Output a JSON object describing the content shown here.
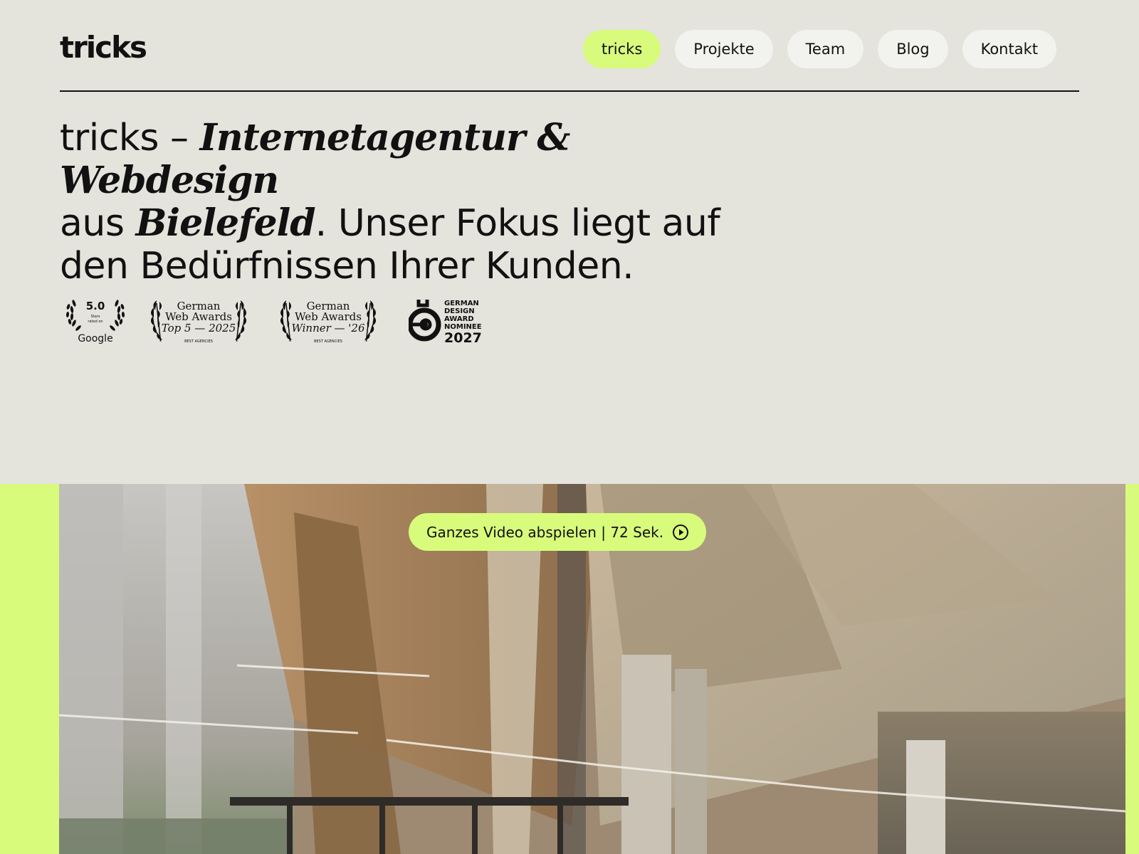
{
  "header": {
    "logo": "tricks",
    "nav": [
      {
        "label": "tricks",
        "active": true
      },
      {
        "label": "Projekte",
        "active": false
      },
      {
        "label": "Team",
        "active": false
      },
      {
        "label": "Blog",
        "active": false
      },
      {
        "label": "Kontakt",
        "active": false
      }
    ]
  },
  "hero": {
    "headline_part1": "tricks – ",
    "headline_italic1": "Internetagentur & Webdesign",
    "headline_part2": "aus ",
    "headline_italic2": "Bielefeld",
    "headline_part3": ". Unser Fokus liegt auf den Bedürfnissen Ihrer Kunden."
  },
  "awards": {
    "google": {
      "rating": "5.0",
      "line1": "Stars",
      "line2": "rated on",
      "brand": "Google"
    },
    "gwa_top5": {
      "line1": "German",
      "line2": "Web Awards",
      "line3": "Top 5 — 2025",
      "footer": "BEST AGENCIES"
    },
    "gwa_winner": {
      "line1": "German",
      "line2": "Web Awards",
      "line3": "Winner — '26",
      "footer": "BEST AGENCIES"
    },
    "gda": {
      "line1": "GERMAN",
      "line2": "DESIGN",
      "line3": "AWARD",
      "line4": "NOMINEE",
      "year": "2027"
    }
  },
  "video": {
    "play_label": "Ganzes Video abspielen | 72 Sek.",
    "play_icon": "play-circle-icon",
    "accent_color": "#d8fb7c"
  }
}
